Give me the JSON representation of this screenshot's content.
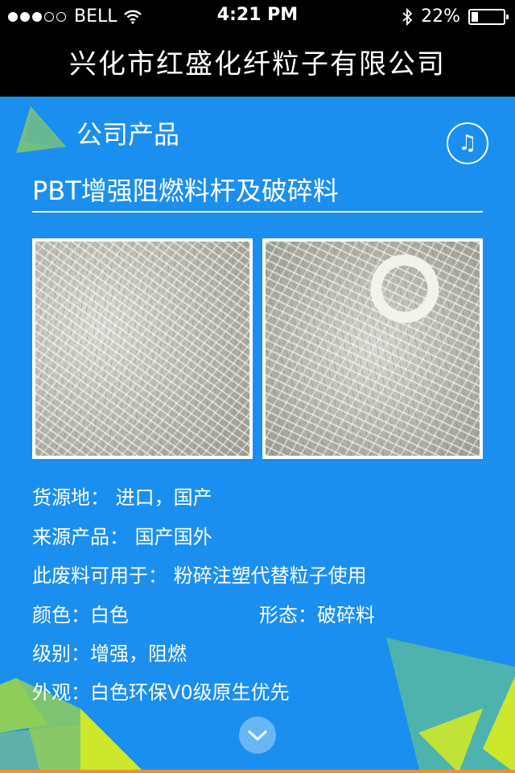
{
  "status_bar": {
    "carrier": "BELL",
    "time": "4:21 PM",
    "battery": "22%",
    "battery_level": 0.22,
    "signal_bars": 3,
    "icons": [
      "signal-dots-icon",
      "wifi-icon",
      "bluetooth-icon",
      "battery-icon"
    ]
  },
  "header": {
    "title": "兴化市红盛化纤粒子有限公司"
  },
  "section": {
    "title": "公司产品",
    "music_icon": "music-note-icon",
    "music_glyph": "♫"
  },
  "product": {
    "title": "PBT增强阻燃料杆及破碎料",
    "images": [
      "product-photo-1",
      "product-photo-2"
    ],
    "details": {
      "origin": "货源地： 进口，国产",
      "source": "来源产品： 国产国外",
      "usage": "此废料可用于： 粉碎注塑代替粒子使用",
      "color": "颜色：白色",
      "form": "形态：破碎料",
      "grade": "级别：增强，阻燃",
      "appearance": "外观：白色环保V0级原生优先"
    }
  },
  "nav": {
    "scroll_icon": "chevron-down-icon"
  },
  "colors": {
    "background": "#1a8ff0",
    "bars": "#000000",
    "accent_green": "#8fcd5a",
    "accent_teal": "#4fb3ad",
    "accent_lime": "#cde82a",
    "bottom_line": "#f2912b"
  }
}
